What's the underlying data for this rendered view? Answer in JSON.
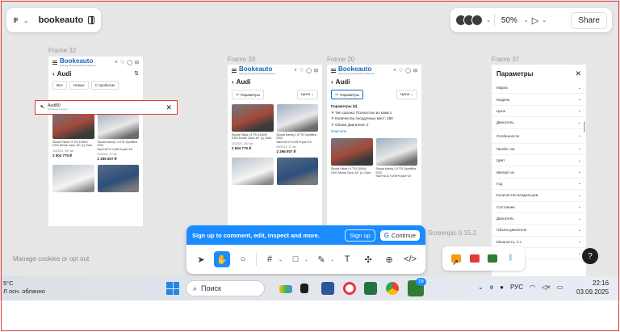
{
  "file": {
    "name": "bookeauto"
  },
  "toolbar": {
    "zoom": "50%",
    "share": "Share"
  },
  "frame_labels": [
    "Frame 32",
    "Frame 33",
    "Frame 20",
    "Frame 37"
  ],
  "app": {
    "logo": "Bookeauto",
    "tagline": "Аренда автомобилей из Европы",
    "brand": "Audi",
    "tabs": [
      "Все",
      "Новые",
      "С пробегом"
    ],
    "search_value": "Audi80",
    "search_hint": "Название модели",
    "params_button": "Параметры",
    "price_select": "Цена",
    "params_title": "Параметры (3)",
    "params_lines": [
      "Тип салона: Полностью из кожи 1",
      "Количество посадочных мест: 180",
      "Объем двигателя: 2"
    ],
    "clear": "Очистить",
    "cars": [
      {
        "title": "Skoda Fabia I.9 TSI 110kW DSG Monte Carlo 18'' (L) Gara",
        "meta": "10/2024, 397 км",
        "price": "2 504 775 ₽"
      },
      {
        "title": "Skoda Kamiq 1.5 TSI SportBne DSG Navi+ACC+LKW+Kpac+18",
        "meta": "09/2024, 37 км",
        "price": "2 266 807 ₽"
      }
    ]
  },
  "params_panel": {
    "title": "Параметры",
    "items": [
      "Марка",
      "Модель",
      "Цена",
      "Двигатель",
      "Особенности",
      "Пробег, км",
      "Цвет",
      "Импорт из",
      "Год",
      "Количество владельцев",
      "Состояние",
      "Двигатель",
      "Объем двигателя",
      "Мощность, л.с.",
      "Расход"
    ]
  },
  "signup": {
    "text": "Sign up to comment, edit, inspect and more.",
    "signup_btn": "Sign up",
    "continue_btn": "Continue"
  },
  "screenpic": "Screenpic 0.15.2",
  "cookies": "Manage cookies or opt out",
  "taskbar": {
    "weather_temp": "5°C",
    "weather_desc": "Л осн. облачно",
    "search": "Поиск",
    "lang": "РУС",
    "time": "22:16",
    "date": "03.09.2025",
    "badge": "16"
  },
  "colors": {
    "accent": "#1a8cff",
    "brand": "#1565c0",
    "highlight": "#e53935"
  }
}
